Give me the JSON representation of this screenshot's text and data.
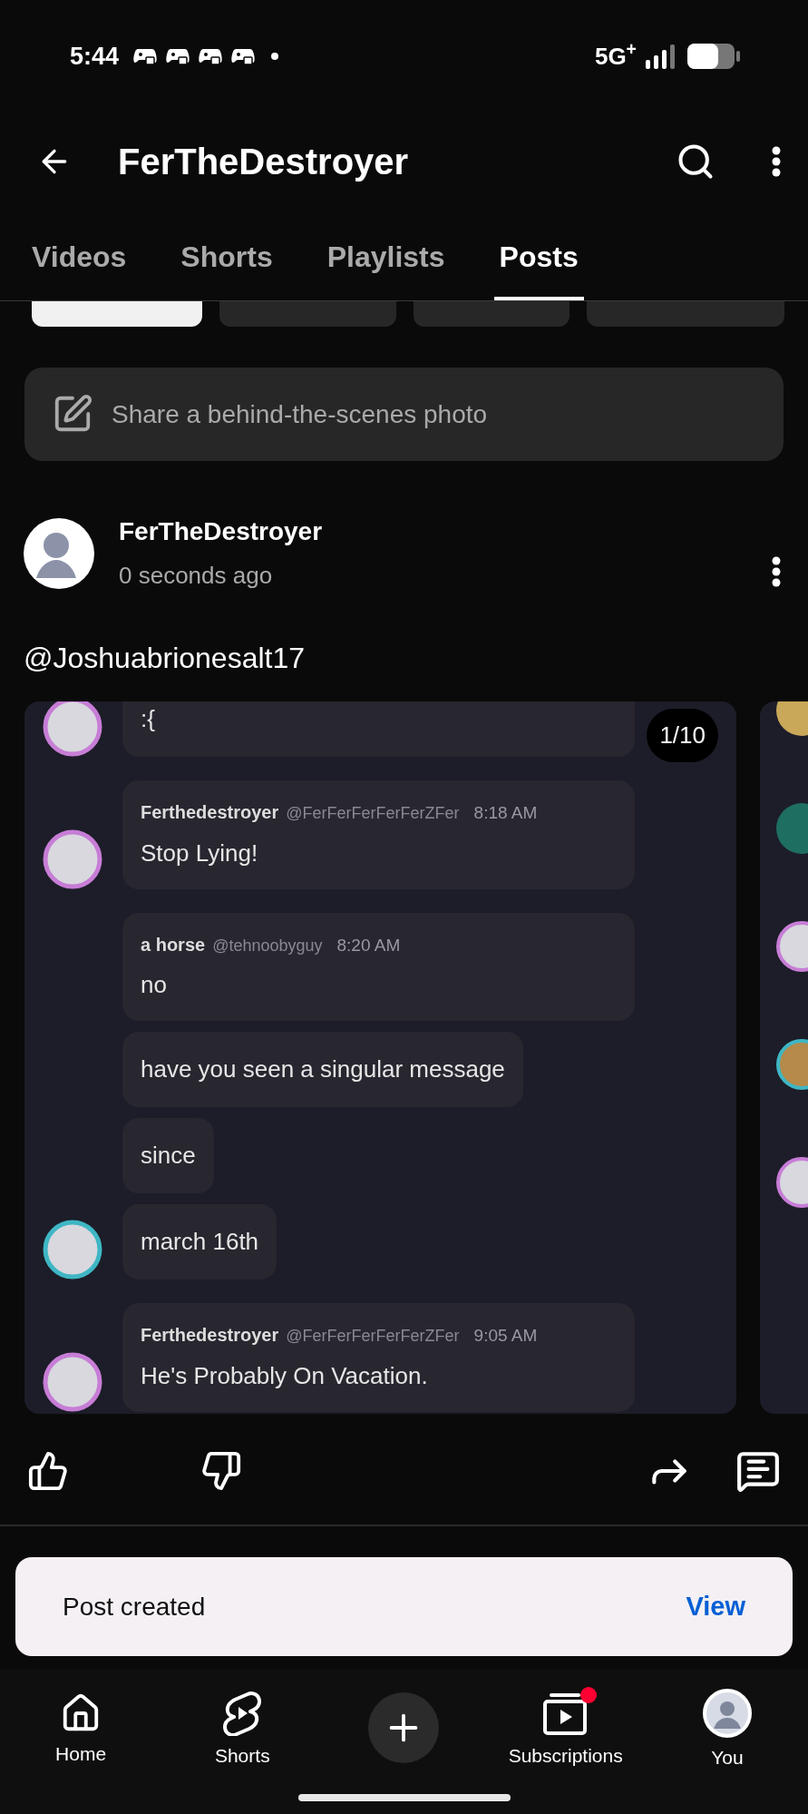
{
  "status_bar": {
    "time": "5:44",
    "network": "5G$^{+}$"
  },
  "header": {
    "title": "FerTheDestroyer"
  },
  "tabs": [
    {
      "label": "Videos",
      "selected": false
    },
    {
      "label": "Shorts",
      "selected": false
    },
    {
      "label": "Playlists",
      "selected": false
    },
    {
      "label": "Posts",
      "selected": true
    }
  ],
  "filter_chips": [
    {
      "selected": true
    },
    {
      "selected": false
    },
    {
      "selected": false
    },
    {
      "selected": false
    }
  ],
  "composer": {
    "placeholder": "Share a behind-the-scenes photo"
  },
  "post": {
    "author": "FerTheDestroyer",
    "time": "0 seconds ago",
    "text": "@Joshuabrionesalt17",
    "image_counter": "1/10",
    "chat": [
      {
        "text": ":{",
        "avatar": true,
        "color": "#c77dd6"
      },
      {
        "author": "Ferthedestroyer",
        "handle": "@FerFerFerFerFerZFer",
        "time": "8:18 AM",
        "text": "Stop Lying!",
        "avatar": true,
        "color": "#c77dd6"
      },
      {
        "author": "a horse",
        "handle": "@tehnoobyguy",
        "time": "8:20 AM",
        "text": "no",
        "avatar": false
      },
      {
        "text": "have you seen a singular message",
        "avatar": false
      },
      {
        "text": "since",
        "avatar": false
      },
      {
        "text": "march 16th",
        "avatar": true,
        "color": "#3fb6c4"
      },
      {
        "author": "Ferthedestroyer",
        "handle": "@FerFerFerFerFerZFer",
        "time": "9:05 AM",
        "text": "He's Probably On Vacation.",
        "avatar": true,
        "color": "#c77dd6"
      }
    ]
  },
  "toast": {
    "message": "Post created",
    "action": "View"
  },
  "bottom_nav": [
    {
      "label": "Home",
      "kind": "home",
      "badge": false
    },
    {
      "label": "Shorts",
      "kind": "shorts",
      "badge": false
    },
    {
      "kind": "create"
    },
    {
      "label": "Subscriptions",
      "kind": "subscriptions",
      "badge": true
    },
    {
      "label": "You",
      "kind": "profile",
      "badge": false
    }
  ]
}
